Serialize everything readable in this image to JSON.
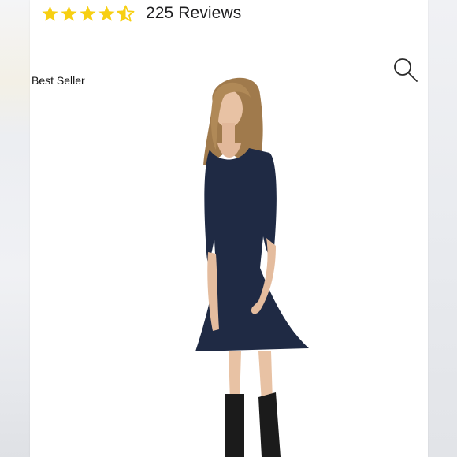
{
  "product": {
    "rating": {
      "value": 4.5,
      "max": 5,
      "star_color": "#f7cf12",
      "review_count_text": "225 Reviews"
    },
    "badge_text": "Best Seller",
    "icons": {
      "search": "search-icon"
    },
    "colors": {
      "dress": "#1f2a44",
      "boots": "#1b1b1b",
      "hair": "#a07a4c",
      "skin": "#e8c2a4"
    }
  }
}
